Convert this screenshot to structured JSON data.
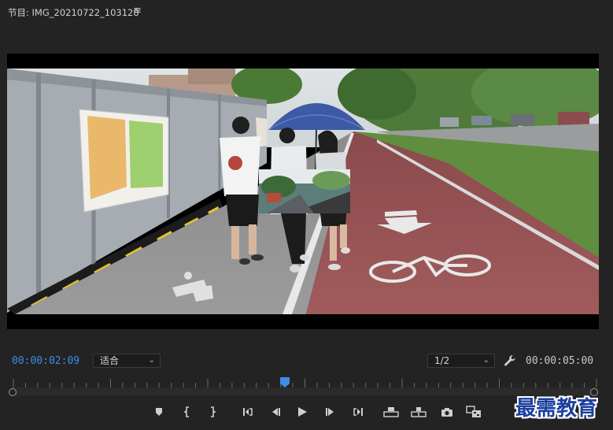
{
  "panel": {
    "title": "节目: IMG_20210722_103128",
    "menu_icon": "hamburger-menu-icon"
  },
  "playback": {
    "current_timecode": "00:00:02:09",
    "duration_timecode": "00:00:05:00",
    "fit_option": "适合",
    "resolution_option": "1/2",
    "accent_color": "#3d8ee6"
  },
  "controls": [
    {
      "name": "add-marker-button",
      "icon": "marker-icon"
    },
    {
      "name": "mark-in-button",
      "icon": "mark-in-icon"
    },
    {
      "name": "mark-out-button",
      "icon": "mark-out-icon"
    },
    {
      "name": "go-to-in-button",
      "icon": "go-to-in-icon"
    },
    {
      "name": "step-back-button",
      "icon": "step-back-icon"
    },
    {
      "name": "play-button",
      "icon": "play-icon"
    },
    {
      "name": "step-forward-button",
      "icon": "step-forward-icon"
    },
    {
      "name": "go-to-out-button",
      "icon": "go-to-out-icon"
    },
    {
      "name": "lift-button",
      "icon": "lift-icon"
    },
    {
      "name": "extract-button",
      "icon": "extract-icon"
    },
    {
      "name": "export-frame-button",
      "icon": "camera-icon"
    },
    {
      "name": "comparison-view-button",
      "icon": "comparison-icon"
    }
  ],
  "watermark": {
    "text": "最需教育"
  }
}
